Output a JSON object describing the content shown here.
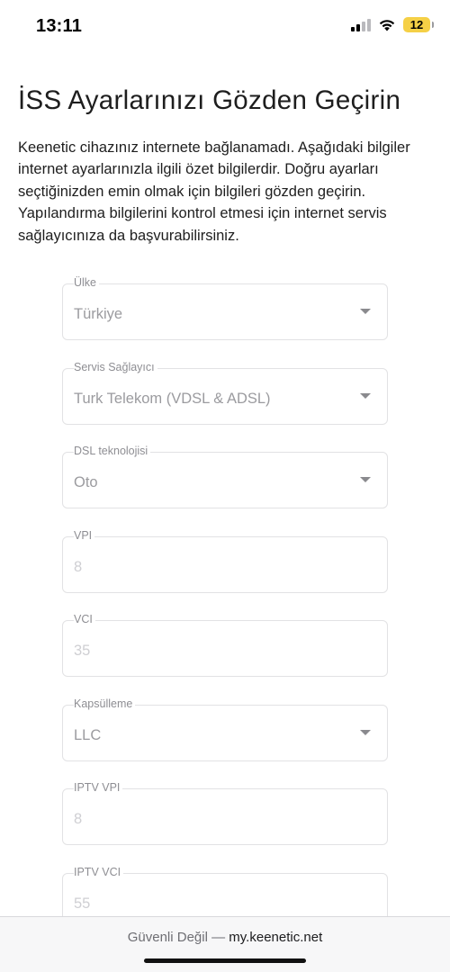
{
  "status_bar": {
    "time": "13:11",
    "battery_level": "12",
    "signal_bars_active": 2,
    "signal_bars_total": 4,
    "battery_color": "#f5d046"
  },
  "page": {
    "title": "İSS Ayarlarınızı Gözden Geçirin",
    "intro": "Keenetic cihazınız internete bağlanamadı. Aşağıdaki bilgiler internet ayarlarınızla ilgili özet bilgilerdir. Doğru ayarları seçtiğinizden emin olmak için bilgileri gözden geçirin. Yapılandırma bilgilerini kontrol etmesi için internet servis sağlayıcınıza da başvurabilirsiniz."
  },
  "form": {
    "country": {
      "label": "Ülke",
      "value": "Türkiye"
    },
    "provider": {
      "label": "Servis Sağlayıcı",
      "value": "Turk Telekom (VDSL & ADSL)"
    },
    "dsl_technology": {
      "label": "DSL teknolojisi",
      "value": "Oto"
    },
    "vpi": {
      "label": "VPI",
      "placeholder": "8"
    },
    "vci": {
      "label": "VCI",
      "placeholder": "35"
    },
    "encapsulation": {
      "label": "Kapsülleme",
      "value": "LLC"
    },
    "iptv_vpi": {
      "label": "IPTV VPI",
      "placeholder": "8"
    },
    "iptv_vci": {
      "label": "IPTV VCI",
      "placeholder": "55"
    }
  },
  "browser": {
    "security_label": "Güvenli Değil —",
    "domain": "my.keenetic.net"
  }
}
